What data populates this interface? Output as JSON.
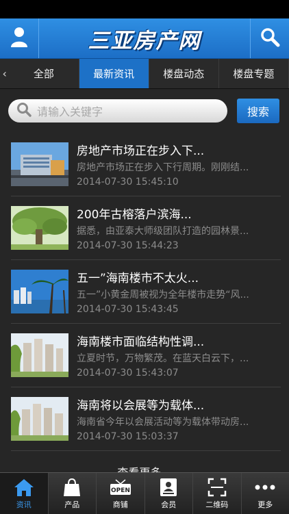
{
  "header": {
    "title": "三亚房产网",
    "user_icon": "user-icon",
    "search_icon": "search-icon"
  },
  "tabs": [
    {
      "label": "全部"
    },
    {
      "label": "最新资讯"
    },
    {
      "label": "楼盘动态"
    },
    {
      "label": "楼盘专题"
    }
  ],
  "search": {
    "placeholder": "请输入关键字",
    "button": "搜索"
  },
  "news": [
    {
      "title": "房地产市场正在步入下...",
      "summary": "房地产市场正在步入下行周期。刚刚结...",
      "date": "2014-07-30 15:45:10"
    },
    {
      "title": "200年古榕落户滨海...",
      "summary": "据悉，由亚泰大师级团队打造的园林景...",
      "date": "2014-07-30 15:44:23"
    },
    {
      "title": "五一”海南楼市不太火...",
      "summary": "五一”小黄金周被视为全年楼市走势“风...",
      "date": "2014-07-30 15:43:45"
    },
    {
      "title": "海南楼市面临结构性调...",
      "summary": "立夏时节，万物繁茂。在蓝天白云下，...",
      "date": "2014-07-30 15:43:07"
    },
    {
      "title": "海南将以会展等为载体...",
      "summary": "海南省今年以会展活动等为载体带动房...",
      "date": "2014-07-30 15:03:37"
    }
  ],
  "more_label": "查看更多...",
  "bottom_nav": [
    {
      "label": "资讯",
      "icon": "home-icon"
    },
    {
      "label": "产品",
      "icon": "bag-icon"
    },
    {
      "label": "商铺",
      "icon": "shop-sign-icon"
    },
    {
      "label": "会员",
      "icon": "member-card-icon"
    },
    {
      "label": "二维码",
      "icon": "qr-scan-icon"
    },
    {
      "label": "更多",
      "icon": "more-dots-icon"
    }
  ],
  "colors": {
    "accent": "#1d71c7",
    "background": "#262626",
    "active_nav_label": "#3b9af0"
  }
}
